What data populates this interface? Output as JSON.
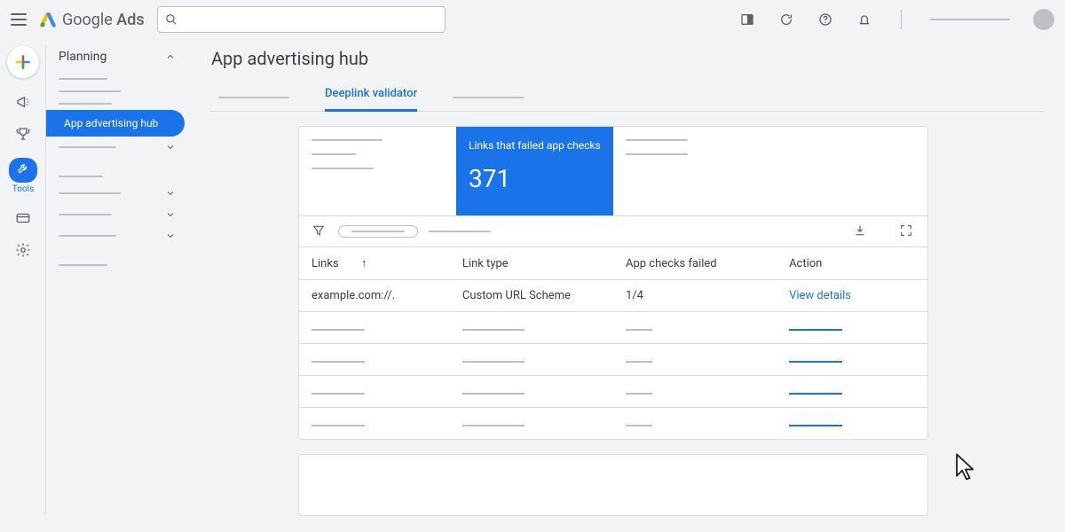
{
  "brand": {
    "product": "Google",
    "subproduct": "Ads"
  },
  "search": {
    "placeholder": ""
  },
  "leftrail": {
    "tools_label": "Tools"
  },
  "sidepanel": {
    "title": "Planning",
    "active_item": "App advertising hub"
  },
  "page": {
    "title": "App advertising hub",
    "active_tab": "Deeplink validator"
  },
  "scorecards": {
    "failed_label": "Links that failed app checks",
    "failed_value": "371"
  },
  "table": {
    "headers": {
      "links": "Links",
      "link_type": "Link type",
      "app_checks_failed": "App checks failed",
      "action": "Action"
    },
    "rows": [
      {
        "link": "example.com://.",
        "link_type": "Custom URL Scheme",
        "checks": "1/4",
        "action": "View details"
      }
    ]
  }
}
